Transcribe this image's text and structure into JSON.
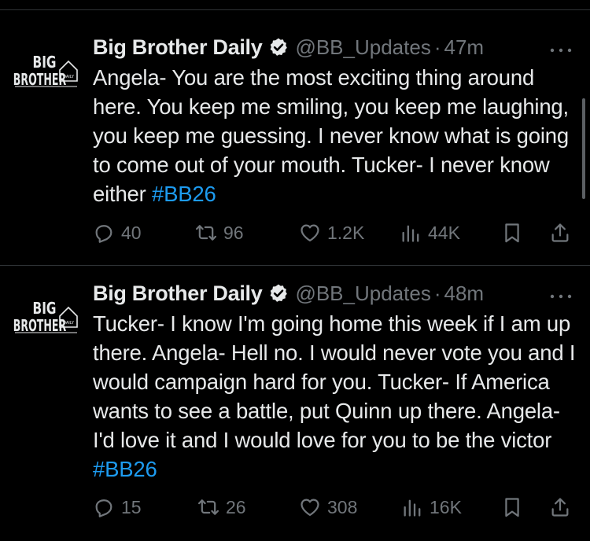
{
  "tweets": [
    {
      "author_name": "Big Brother Daily",
      "handle": "@BB_Updates",
      "separator": "·",
      "time": "47m",
      "text": "Angela- You are the most exciting thing around here. You keep me smiling, you keep me laughing, you keep me guessing. I never know what is going to come out of your mouth. Tucker- I never know either ",
      "hashtag": "#BB26",
      "replies": "40",
      "reposts": "96",
      "likes": "1.2K",
      "views": "44K",
      "avatar": {
        "line1": "BIG",
        "line2": "BROTHER",
        "line3": "DAILY"
      }
    },
    {
      "author_name": "Big Brother Daily",
      "handle": "@BB_Updates",
      "separator": "·",
      "time": "48m",
      "text": "Tucker- I know I'm going home this week if I am up there. Angela- Hell no. I would never vote you and I would campaign hard for you. Tucker- If America wants to see a battle, put Quinn up there. Angela- I'd love it and I would love for you to be the victor ",
      "hashtag": "#BB26",
      "replies": "15",
      "reposts": "26",
      "likes": "308",
      "views": "16K",
      "avatar": {
        "line1": "BIG",
        "line2": "BROTHER",
        "line3": "DAILY"
      }
    }
  ],
  "icons": {
    "verified": "verified-badge-icon",
    "more": "more-dots-icon",
    "reply": "reply-icon",
    "repost": "repost-icon",
    "like": "heart-icon",
    "views": "views-bar-icon",
    "bookmark": "bookmark-icon",
    "share": "share-icon"
  },
  "colors": {
    "background": "#000000",
    "text": "#e7e9ea",
    "muted": "#71767b",
    "accent": "#1d9bf0",
    "divider": "#2f3336"
  }
}
